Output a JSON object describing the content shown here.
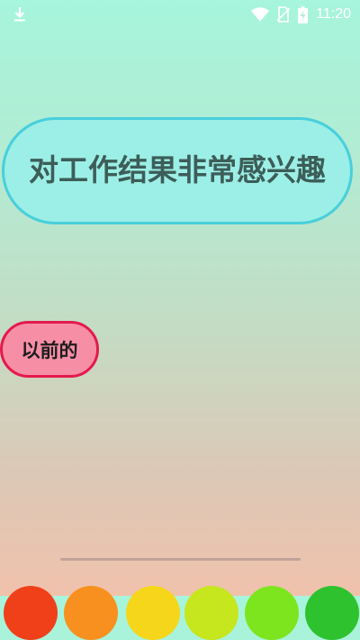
{
  "status_bar": {
    "time": "11:20",
    "icons": [
      "download-icon",
      "wifi-icon",
      "no-sim-icon",
      "battery-charging-icon"
    ]
  },
  "question": {
    "text": "对工作结果非常感兴趣"
  },
  "options": [
    {
      "label": "以前的",
      "color": "#f68fa6",
      "border_color": "#e5194d"
    }
  ],
  "palette": {
    "colors": [
      "#f0401a",
      "#f7901e",
      "#f5d61a",
      "#c6e61e",
      "#7de51e",
      "#2ec22e"
    ]
  }
}
